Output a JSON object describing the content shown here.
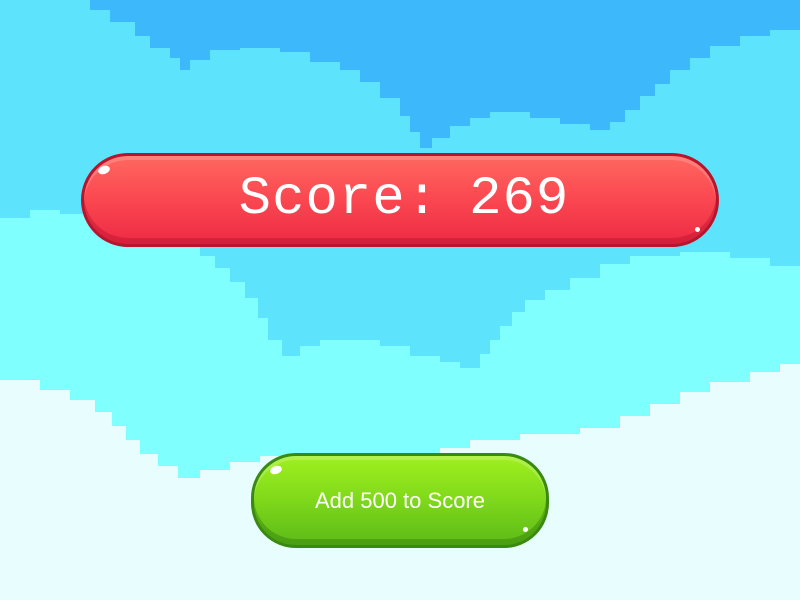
{
  "score_display": {
    "label": "Score:",
    "value": "269",
    "color": "#ff4d55"
  },
  "add_button": {
    "label": "Add 500 to Score",
    "color": "#84dc1a"
  },
  "background": {
    "sky_dark": "#3db9fb",
    "sky_mid": "#5ee3fd",
    "sky_light": "#7ffffd",
    "sky_pale": "#e8fefe"
  }
}
